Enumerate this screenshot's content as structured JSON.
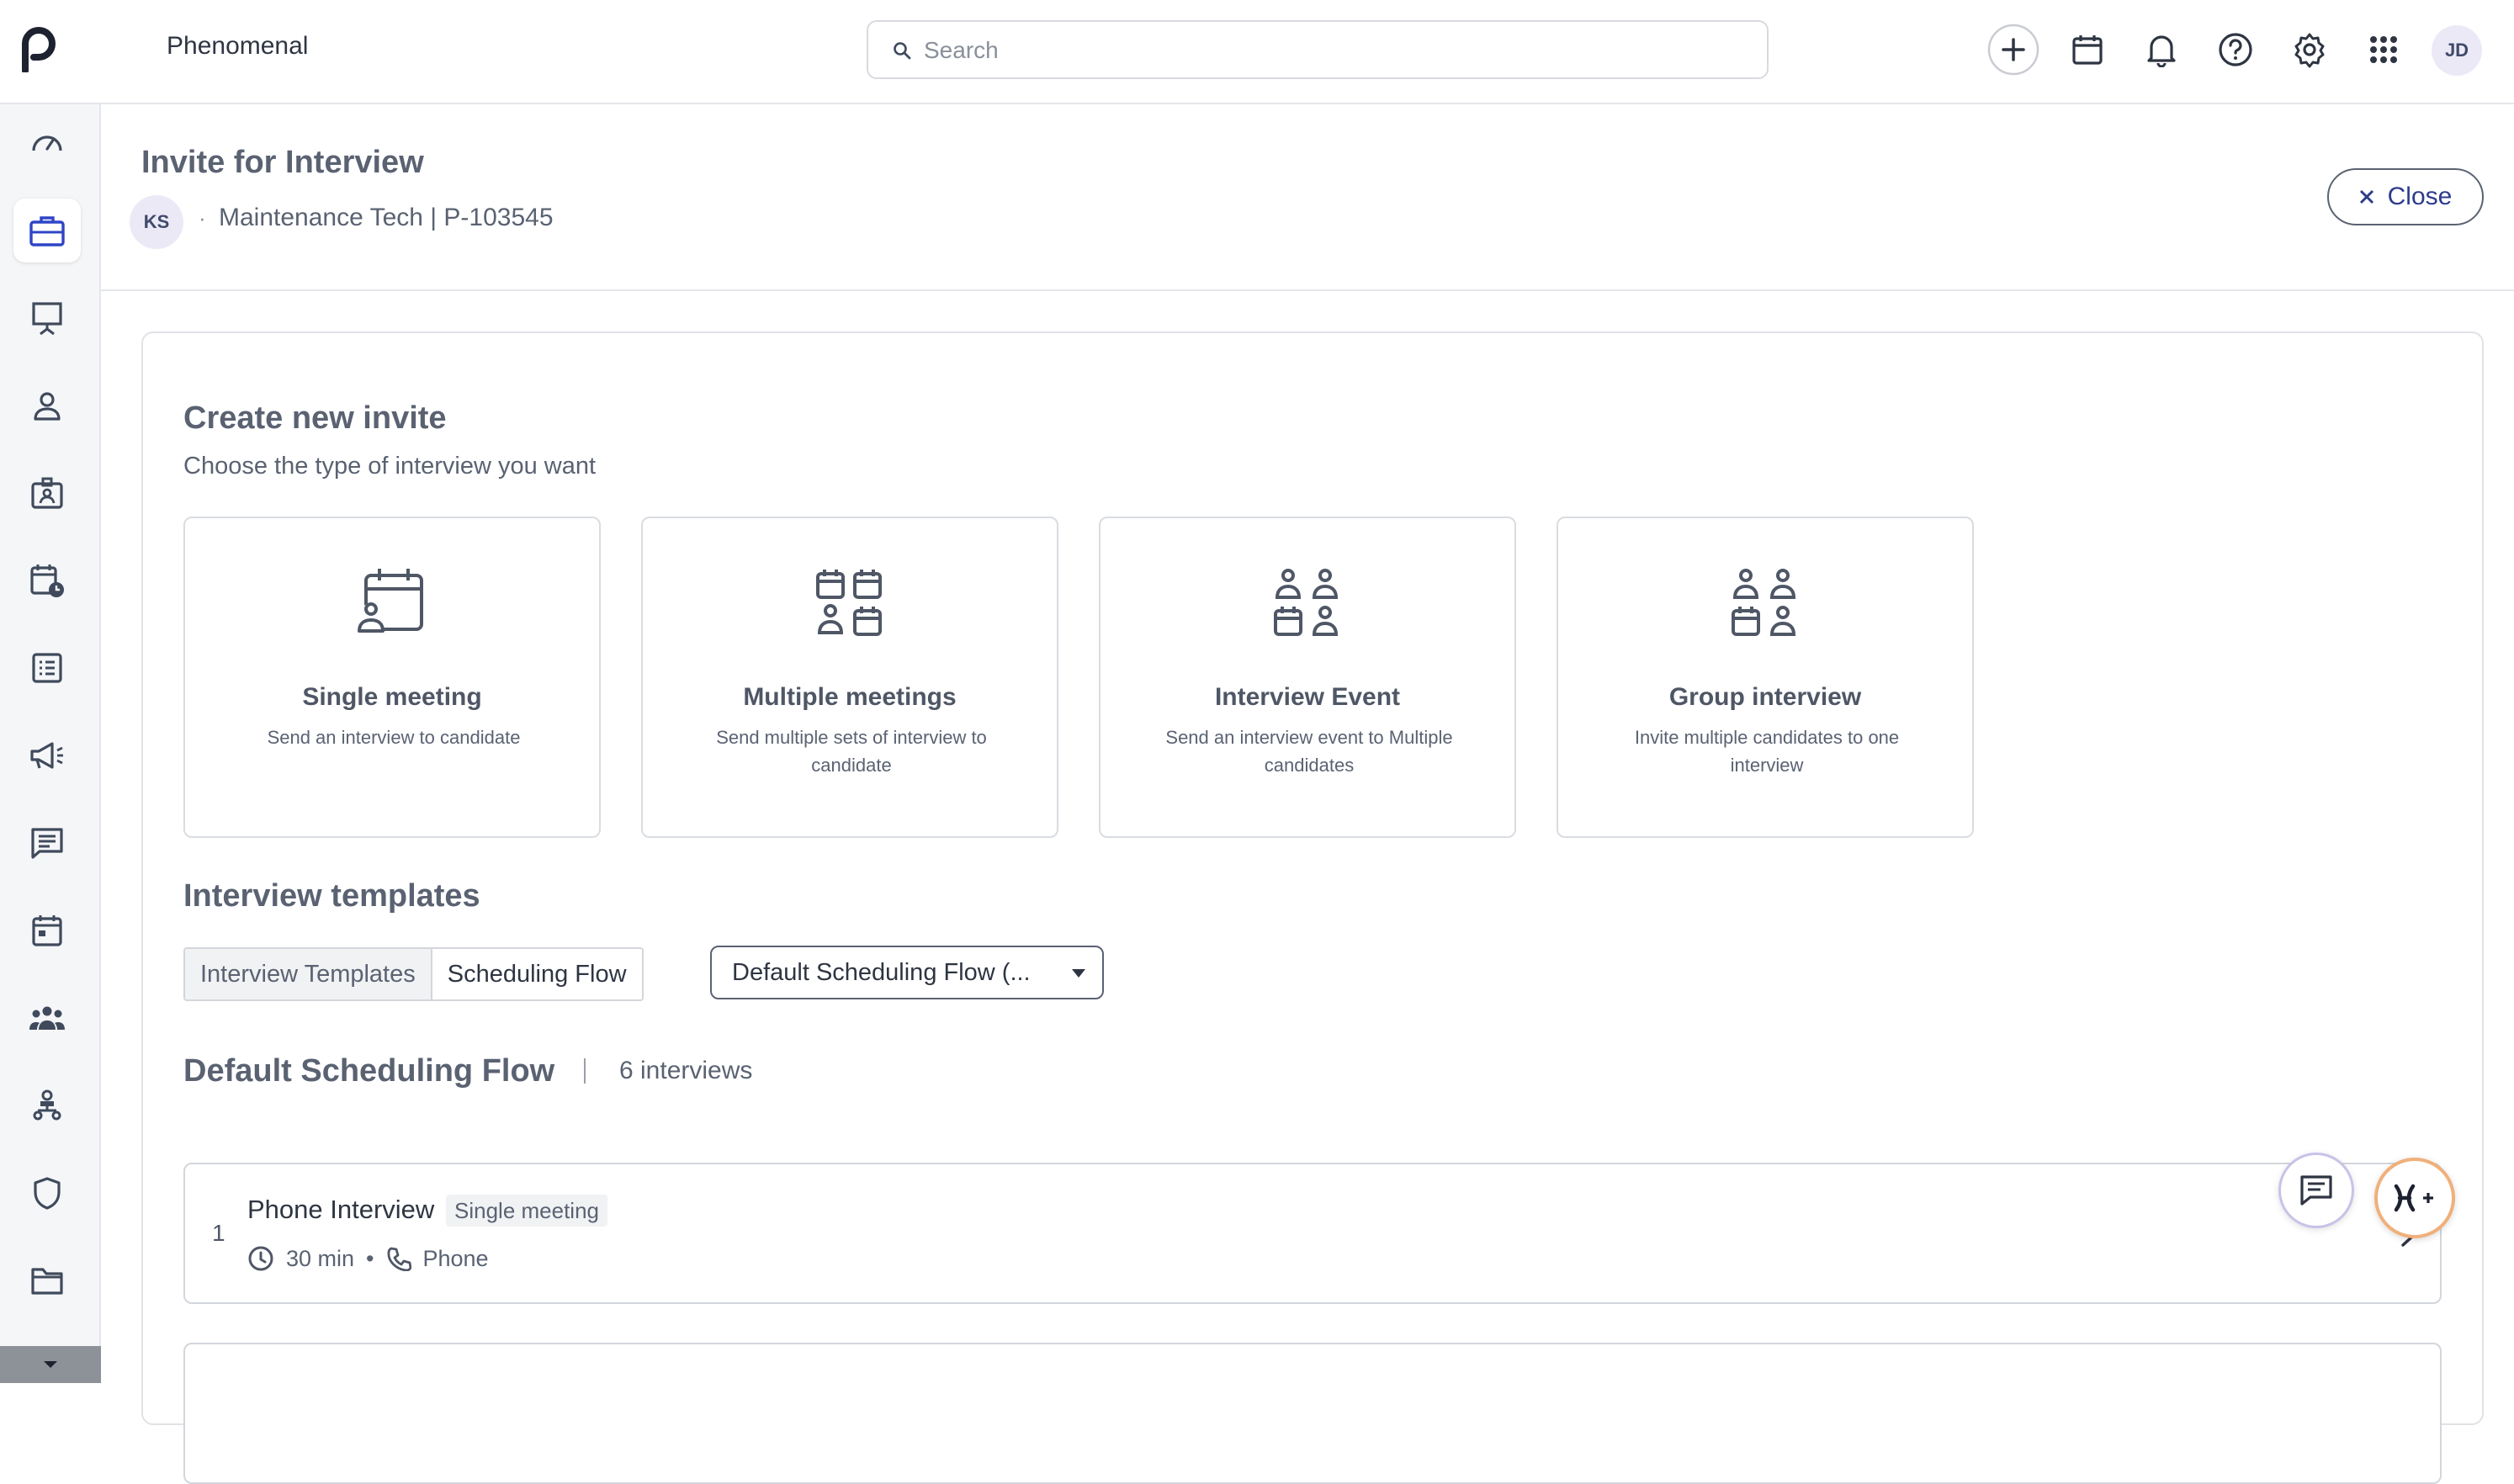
{
  "app": {
    "name": "Phenomenal"
  },
  "search": {
    "placeholder": "Search"
  },
  "user": {
    "initials": "JD"
  },
  "header": {
    "title": "Invite for Interview",
    "candidate_initials": "KS",
    "separator": "·",
    "job": "Maintenance Tech | P-103545",
    "close_label": "Close"
  },
  "create": {
    "title": "Create new invite",
    "subtitle": "Choose the type of interview you want",
    "types": [
      {
        "title": "Single meeting",
        "desc": "Send an interview to candidate",
        "icon": "calendar-person-icon"
      },
      {
        "title": "Multiple meetings",
        "desc": "Send multiple sets of interview to candidate",
        "icon": "multi-calendar-icon"
      },
      {
        "title": "Interview Event",
        "desc": "Send an interview event to Multiple candidates",
        "icon": "event-people-icon"
      },
      {
        "title": "Group interview",
        "desc": "Invite multiple candidates to one interview",
        "icon": "group-people-icon"
      }
    ]
  },
  "templates": {
    "title": "Interview templates",
    "tabs": [
      "Interview Templates",
      "Scheduling Flow"
    ],
    "selected_tab": "Scheduling Flow",
    "dropdown_value": "Default Scheduling Flow (..."
  },
  "flow": {
    "title": "Default Scheduling Flow",
    "separator": "|",
    "count": "6 interviews",
    "rows": [
      {
        "index": "1",
        "name": "Phone Interview",
        "badge": "Single meeting",
        "duration": "30 min",
        "bullet": "•",
        "mode": "Phone"
      }
    ]
  },
  "colors": {
    "accent": "#2d3b8c",
    "muted_text": "#5a6272",
    "border": "#d3d6db",
    "sidebar_bg": "#f5f6f8"
  }
}
